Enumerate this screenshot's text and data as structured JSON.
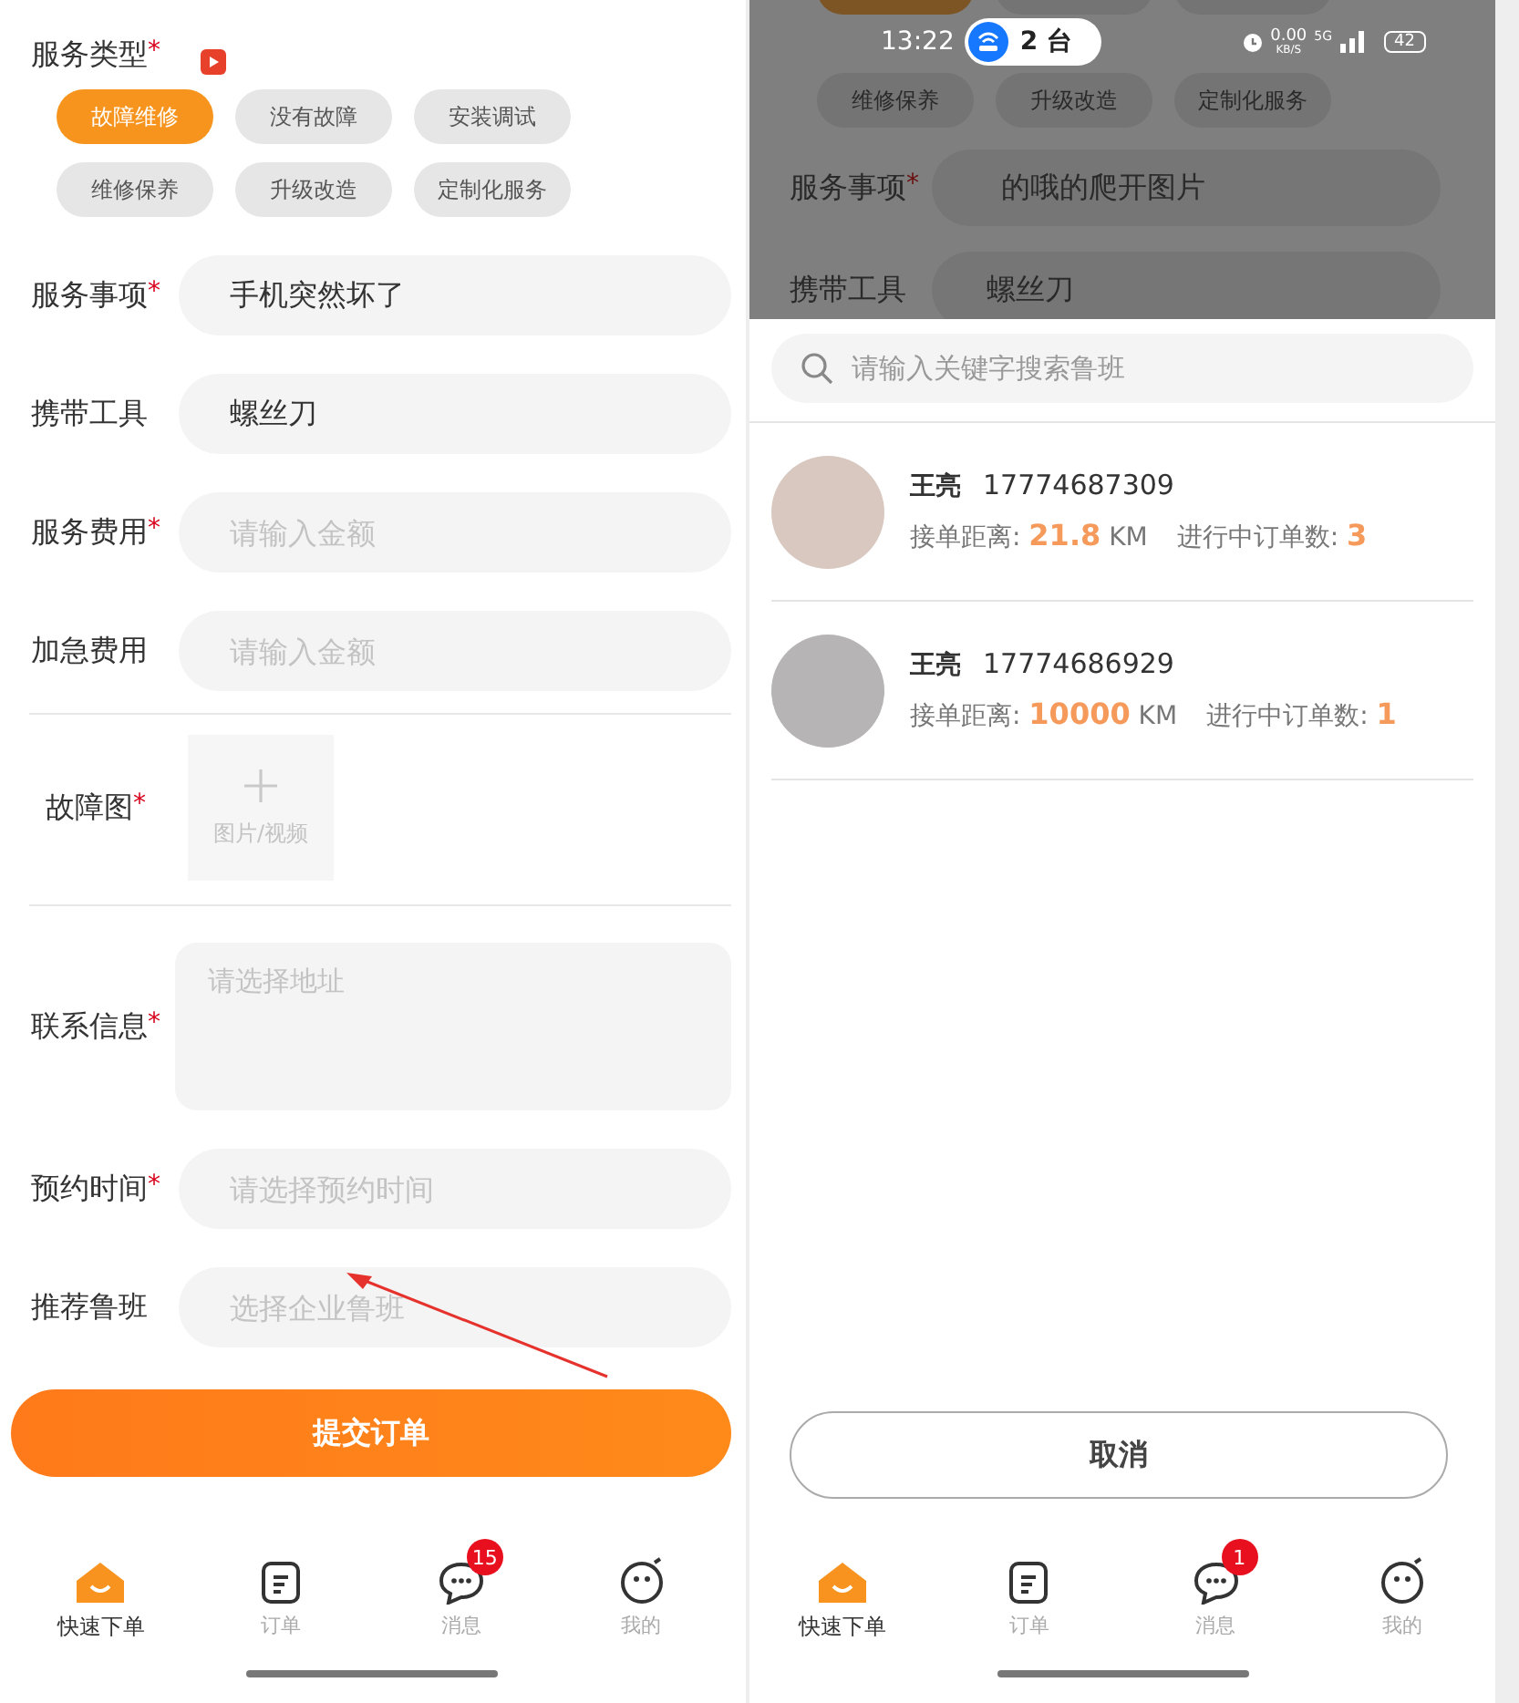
{
  "form_screen": {
    "service_type": {
      "label": "服务类型",
      "required_mark": "*",
      "options": [
        {
          "label": "故障维修",
          "selected": true
        },
        {
          "label": "没有故障",
          "selected": false
        },
        {
          "label": "安装调试",
          "selected": false
        },
        {
          "label": "维修保养",
          "selected": false
        },
        {
          "label": "升级改造",
          "selected": false
        },
        {
          "label": "定制化服务",
          "selected": false
        }
      ]
    },
    "fields": [
      {
        "kind": "input",
        "label": "服务事项",
        "required_mark": "*",
        "value": "手机突然坏了"
      },
      {
        "kind": "input",
        "label": "携带工具",
        "value": "螺丝刀"
      },
      {
        "kind": "input",
        "label": "服务费用",
        "required_mark": "*",
        "placeholder": "请输入金额"
      },
      {
        "kind": "input",
        "label": "加急费用",
        "placeholder": "请输入金额"
      },
      {
        "kind": "upload",
        "label": "故障图",
        "required_mark": "*",
        "placeholder": "图片/视频"
      },
      {
        "kind": "textarea",
        "label": "联系信息",
        "required_mark": "*",
        "placeholder": "请选择地址"
      },
      {
        "kind": "input",
        "label": "预约时间",
        "required_mark": "*",
        "placeholder": "请选择预约时间"
      },
      {
        "kind": "input",
        "label": "推荐鲁班",
        "placeholder": "选择企业鲁班"
      }
    ],
    "submit_button": "提交订单",
    "tab_bar": [
      {
        "label": "快速下单",
        "selected": true
      },
      {
        "label": "订单",
        "selected": false
      },
      {
        "label": "消息",
        "selected": false,
        "badge": "15"
      },
      {
        "label": "我的",
        "selected": false
      }
    ]
  },
  "picker_screen": {
    "status_bar": {
      "time": "13:22",
      "device_count": "2 台",
      "speed": "0.00",
      "speed_unit": "KB/S",
      "network": "5G",
      "battery": "42"
    },
    "background_form": {
      "chips": [
        {
          "label": "维修保养"
        },
        {
          "label": "升级改造"
        },
        {
          "label": "定制化服务"
        }
      ],
      "fields": [
        {
          "label": "服务事项",
          "required_mark": "*",
          "value": "的哦的爬开图片"
        },
        {
          "label": "携带工具",
          "value": "螺丝刀"
        }
      ]
    },
    "search": {
      "placeholder": "请输入关键字搜索鲁班"
    },
    "workers": [
      {
        "name": "王亮",
        "phone": "17774687309",
        "distance_label": "接单距离:",
        "distance": "21.8",
        "distance_unit": "KM",
        "orders_label": "进行中订单数:",
        "orders": "3"
      },
      {
        "name": "王亮",
        "phone": "17774686929",
        "distance_label": "接单距离:",
        "distance": "10000",
        "distance_unit": "KM",
        "orders_label": "进行中订单数:",
        "orders": "1"
      }
    ],
    "cancel_button": "取消",
    "tab_bar": [
      {
        "label": "快速下单",
        "selected": true
      },
      {
        "label": "订单",
        "selected": false
      },
      {
        "label": "消息",
        "selected": false,
        "badge": "1"
      },
      {
        "label": "我的",
        "selected": false
      }
    ]
  }
}
